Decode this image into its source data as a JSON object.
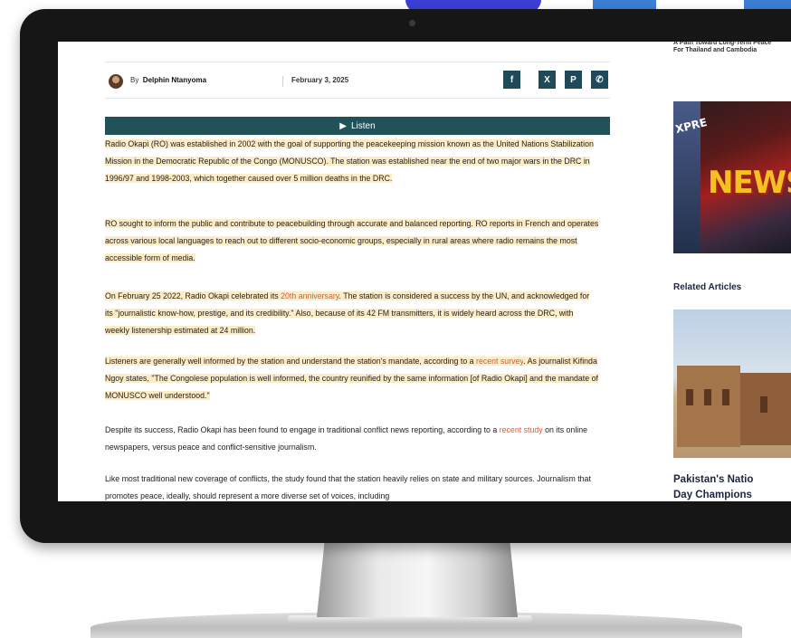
{
  "meta": {
    "colors": {
      "listen_bar": "#215259",
      "share_button": "#1e4a5a",
      "highlight": "#fdecc8",
      "link": "#e4572e",
      "monitor_bezel": "#161616"
    }
  },
  "article": {
    "author_prefix": "By",
    "author_name": "Delphin Ntanyoma",
    "date": "February 3, 2025",
    "share_buttons": [
      {
        "icon": "facebook-icon",
        "glyph": "f"
      },
      {
        "icon": "x-icon",
        "glyph": "X"
      },
      {
        "icon": "pinterest-icon",
        "glyph": "P"
      },
      {
        "icon": "whatsapp-icon",
        "glyph": "✆"
      }
    ],
    "listen_icon": "play-icon",
    "listen_glyph": "▶",
    "listen_label": "Listen",
    "p1": "Radio Okapi (RO) was established in 2002 with the goal of supporting the peacekeeping mission known as the United Nations Stabilization Mission in the Democratic Republic of the Congo (MONUSCO). The station was established near the end of two major wars in the DRC in 1996/97 and 1998-2003, which together caused over 5 million deaths in the DRC.",
    "p2": "RO sought to inform the public and contribute to peacebuilding through accurate and balanced reporting. RO reports in French and operates across various local languages to reach out to different socio-economic groups, especially in rural areas where radio remains the most accessible form of media.",
    "p3_a": "On February 25 2022, Radio Okapi celebrated its ",
    "p3_link": "20th anniversary",
    "p3_b": ". The station is considered a success by the UN, and acknowledged for its \"journalistic know-how, prestige, and its credibility.\" Also, because of its 42 FM transmitters, it is widely heard across the DRC, with weekly listenership estimated at 24 million.",
    "p4_a": "Listeners are generally well informed by the station and understand the station's mandate, according to a ",
    "p4_link": "recent survey",
    "p4_b": ". As journalist Kifinda Ngoy states, \"The Congolese population is well informed, the country reunified by the same information [of Radio Okapi] and the mandate of MONUSCO well understood.\"",
    "p5_a": "Despite its success, Radio Okapi has been found to engage in traditional conflict news reporting, according to a ",
    "p5_link": "recent study",
    "p5_b": " on its online newspapers, versus peace and conflict-sensitive journalism.",
    "p6": "Like most traditional new coverage of conflicts, the study found that the station heavily relies on state and military sources. Journalism that promotes peace, ideally, should represent a more diverse set of voices, including"
  },
  "sidebar": {
    "top_story": "A Path Toward Long-Term Peace For Thailand and Cambodia",
    "news_image_text": "NEWS",
    "news_image_sign": "XPRE",
    "related_heading": "Related Articles",
    "related_headline_1": "Pakistan's Natio",
    "related_headline_2": "Day Champions"
  }
}
